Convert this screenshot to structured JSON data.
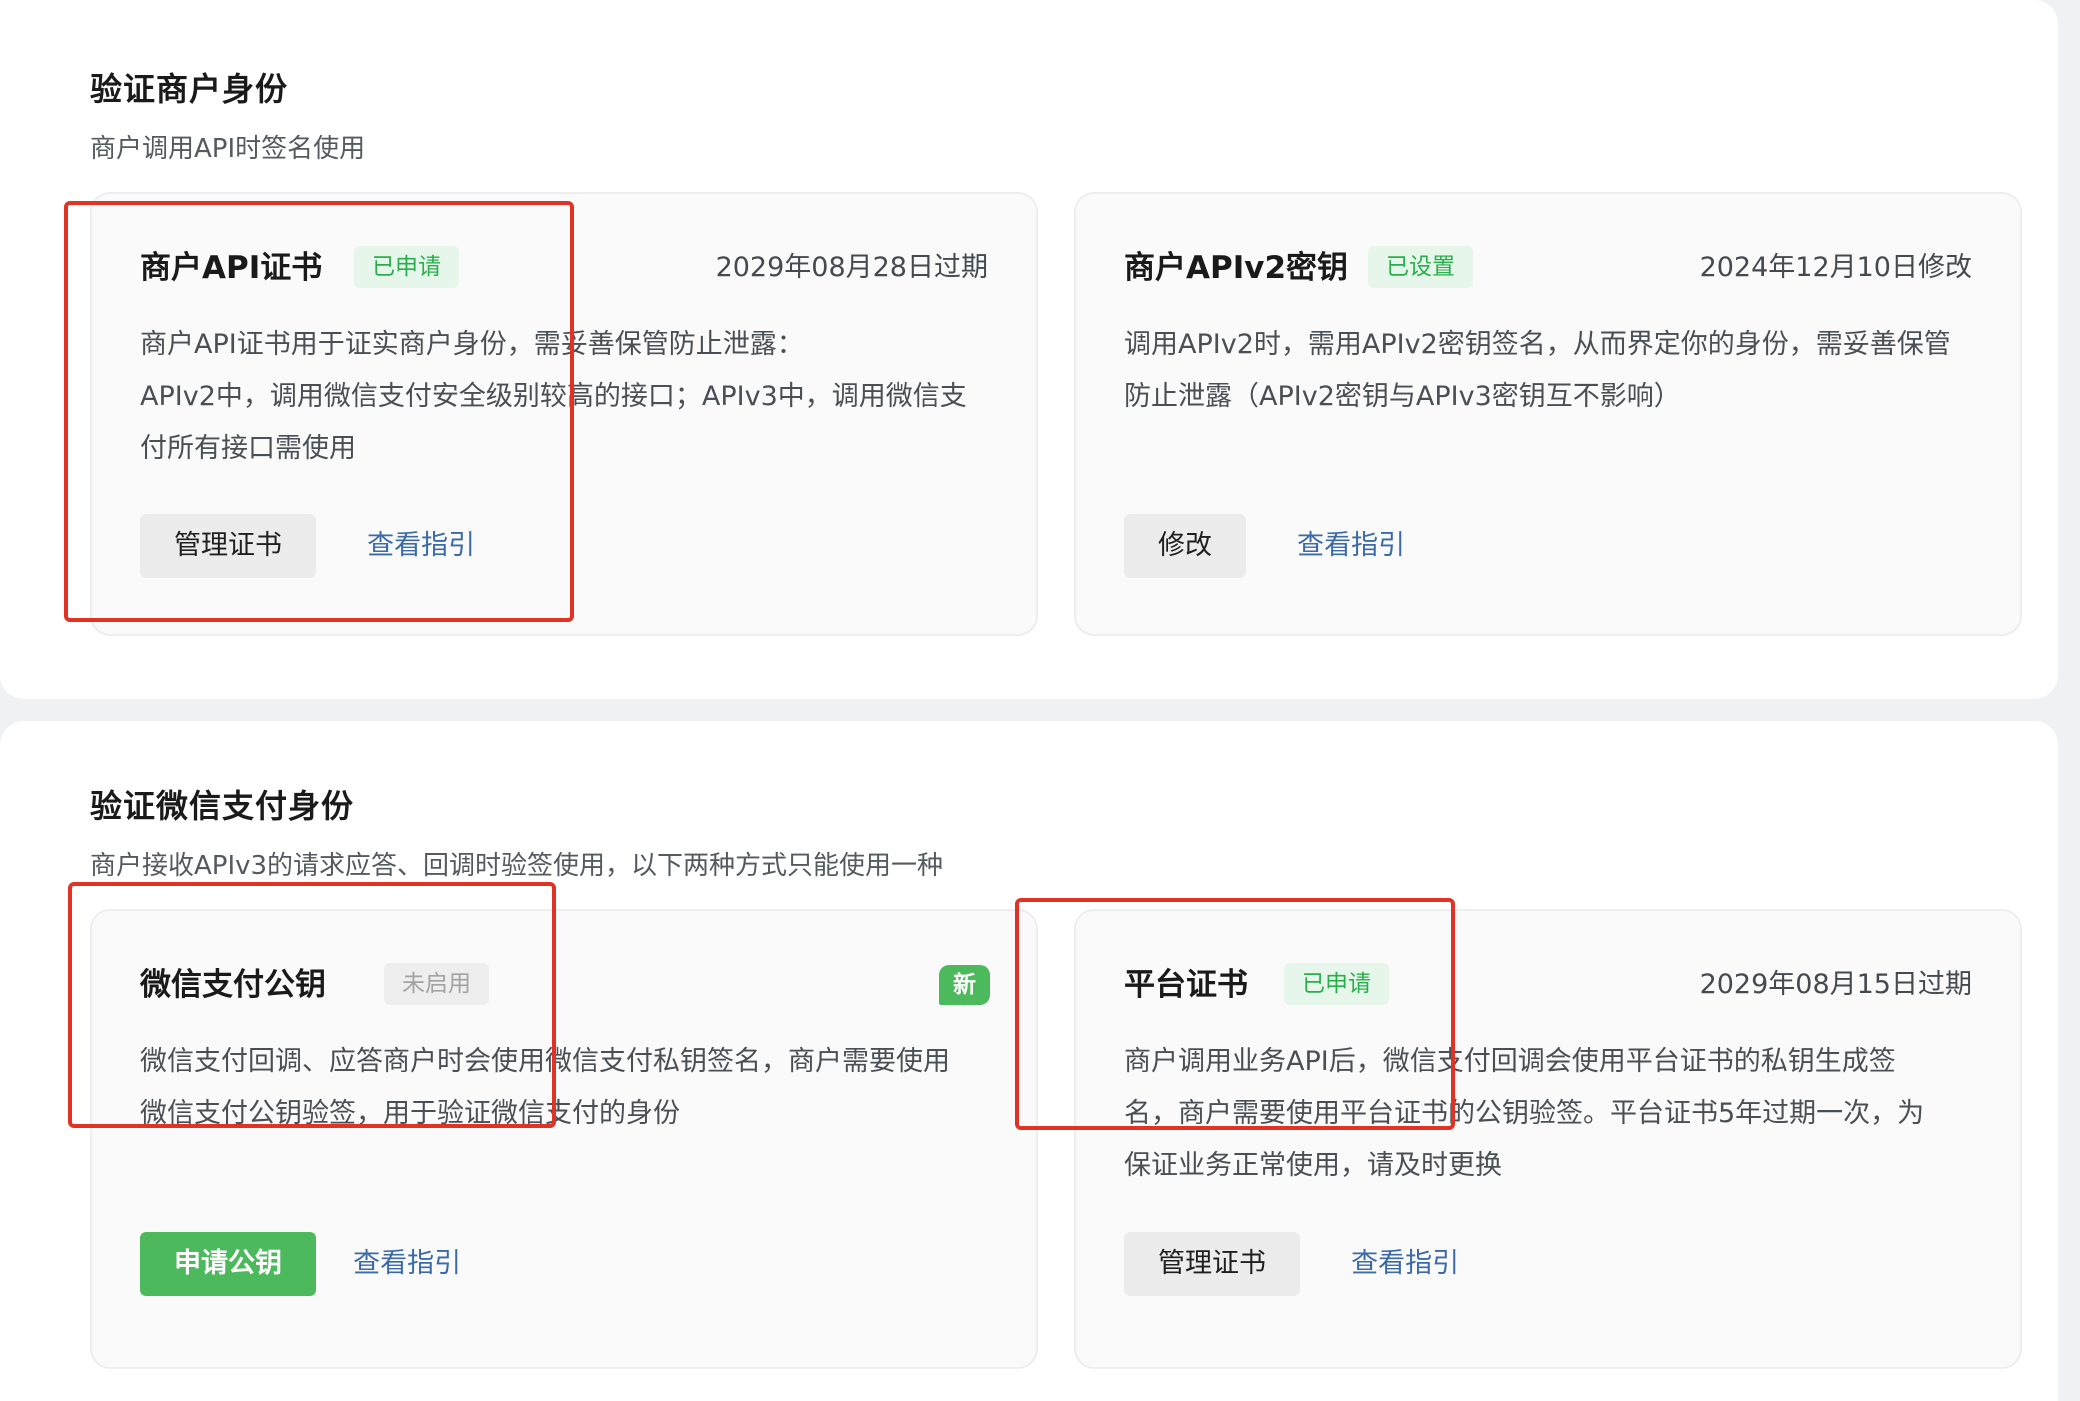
{
  "sections": [
    {
      "title": "验证商户身份",
      "subtitle": "商户调用API时签名使用",
      "cards": [
        {
          "title": "商户API证书",
          "badge": "已申请",
          "meta": "2029年08月28日过期",
          "desc": [
            "商户API证书用于证实商户身份，需妥善保管防止泄露：",
            "APIv2中，调用微信支付安全级别较高的接口；APIv3中，调用微信支",
            "付所有接口需使用"
          ],
          "button": "管理证书",
          "link": "查看指引"
        },
        {
          "title": "商户APIv2密钥",
          "badge": "已设置",
          "meta": "2024年12月10日修改",
          "desc": [
            "调用APIv2时，需用APIv2密钥签名，从而界定你的身份，需妥善保管",
            "防止泄露（APIv2密钥与APIv3密钥互不影响）"
          ],
          "button": "修改",
          "link": "查看指引"
        }
      ]
    },
    {
      "title": "验证微信支付身份",
      "subtitle": "商户接收APIv3的请求应答、回调时验签使用，以下两种方式只能使用一种",
      "cards": [
        {
          "title": "微信支付公钥",
          "badge": "未启用",
          "new_badge": "新",
          "desc": [
            "微信支付回调、应答商户时会使用微信支付私钥签名，商户需要使用",
            "微信支付公钥验签，用于验证微信支付的身份"
          ],
          "button": "申请公钥",
          "link": "查看指引"
        },
        {
          "title": "平台证书",
          "badge": "已申请",
          "meta": "2029年08月15日过期",
          "desc": [
            "商户调用业务API后，微信支付回调会使用平台证书的私钥生成签",
            "名，商户需要使用平台证书的公钥验签。平台证书5年过期一次，为",
            "保证业务正常使用，请及时更换"
          ],
          "button": "管理证书",
          "link": "查看指引"
        }
      ]
    }
  ],
  "colors": {
    "accent": "#4cb95c",
    "link": "#3b6aa8",
    "annotation": "#e03325"
  }
}
